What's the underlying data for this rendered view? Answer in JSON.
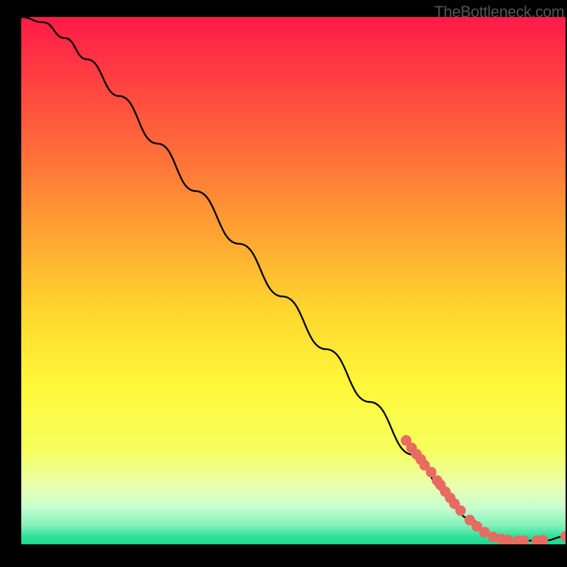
{
  "watermark": "TheBottleneck.com",
  "colors": {
    "background": "#000000",
    "curve": "#000000",
    "points": "#e86b62",
    "watermark": "#555555",
    "gradient_stops": [
      {
        "offset": 0.0,
        "color": "#ff1a49"
      },
      {
        "offset": 0.1,
        "color": "#ff3a42"
      },
      {
        "offset": 0.25,
        "color": "#ff6b3a"
      },
      {
        "offset": 0.4,
        "color": "#ffa033"
      },
      {
        "offset": 0.55,
        "color": "#ffd42e"
      },
      {
        "offset": 0.7,
        "color": "#fff83a"
      },
      {
        "offset": 0.82,
        "color": "#f6ff5c"
      },
      {
        "offset": 0.89,
        "color": "#e9ffb0"
      },
      {
        "offset": 0.93,
        "color": "#c8ffd0"
      },
      {
        "offset": 0.965,
        "color": "#80f0b8"
      },
      {
        "offset": 0.985,
        "color": "#2ee29a"
      },
      {
        "offset": 1.0,
        "color": "#20d68e"
      }
    ]
  },
  "chart_data": {
    "type": "line",
    "title": "",
    "xlabel": "",
    "ylabel": "",
    "xlim": [
      0,
      100
    ],
    "ylim": [
      0,
      100
    ],
    "series": [
      {
        "name": "curve",
        "x": [
          0,
          4,
          8,
          12,
          18,
          25,
          32,
          40,
          48,
          56,
          64,
          72,
          78,
          82,
          86,
          90,
          93,
          96,
          100
        ],
        "values": [
          100,
          99,
          96,
          92,
          85,
          76,
          67,
          57,
          47,
          37,
          27,
          17,
          10,
          5,
          2,
          1,
          0.7,
          0.7,
          1.5
        ]
      }
    ],
    "points": [
      {
        "x": 70.7,
        "y": 19.7
      },
      {
        "x": 71.7,
        "y": 18.3
      },
      {
        "x": 72.6,
        "y": 17.1
      },
      {
        "x": 73.4,
        "y": 16.1
      },
      {
        "x": 74.1,
        "y": 15.0
      },
      {
        "x": 75.3,
        "y": 13.7
      },
      {
        "x": 76.4,
        "y": 12.1
      },
      {
        "x": 77.0,
        "y": 11.3
      },
      {
        "x": 77.9,
        "y": 10.0
      },
      {
        "x": 78.8,
        "y": 8.8
      },
      {
        "x": 79.6,
        "y": 7.7
      },
      {
        "x": 80.7,
        "y": 6.4
      },
      {
        "x": 82.4,
        "y": 4.6
      },
      {
        "x": 83.7,
        "y": 3.4
      },
      {
        "x": 85.1,
        "y": 2.3
      },
      {
        "x": 86.7,
        "y": 1.4
      },
      {
        "x": 88.2,
        "y": 1.0
      },
      {
        "x": 89.4,
        "y": 0.8
      },
      {
        "x": 91.2,
        "y": 0.7
      },
      {
        "x": 92.3,
        "y": 0.7
      },
      {
        "x": 94.7,
        "y": 0.7
      },
      {
        "x": 95.8,
        "y": 0.8
      },
      {
        "x": 100.0,
        "y": 1.5
      }
    ]
  }
}
